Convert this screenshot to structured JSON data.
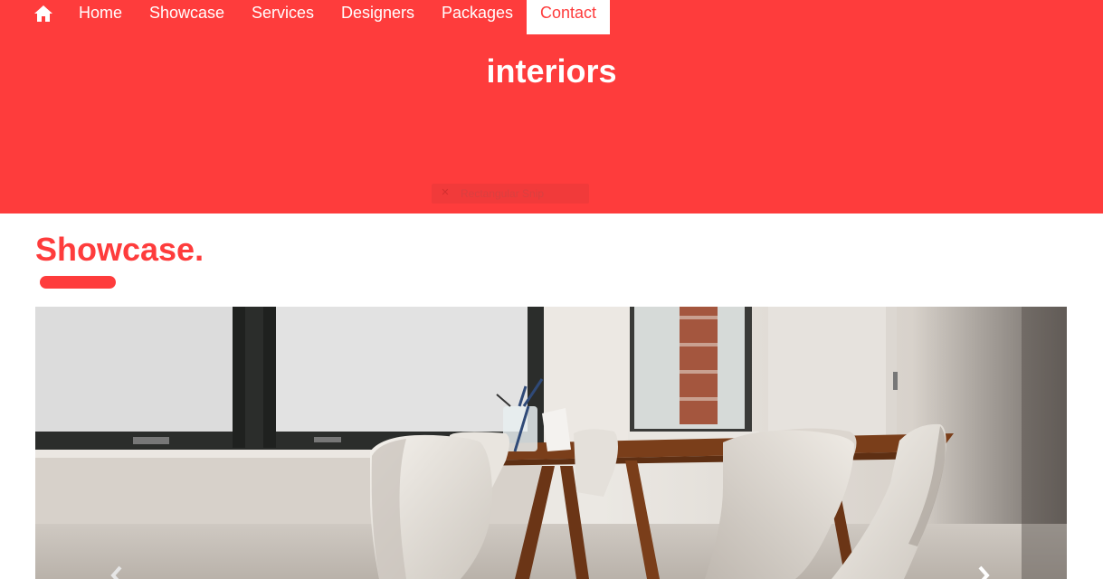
{
  "nav": {
    "home_icon": "home-icon",
    "items": [
      {
        "label": "Home"
      },
      {
        "label": "Showcase"
      },
      {
        "label": "Services"
      },
      {
        "label": "Designers"
      },
      {
        "label": "Packages"
      },
      {
        "label": "Contact",
        "active": true
      }
    ]
  },
  "hero": {
    "brand": "interiors",
    "overlay_label": "Rectangular Snip"
  },
  "showcase": {
    "title": "Showcase."
  },
  "colors": {
    "accent": "#fe3c3c",
    "white": "#ffffff"
  },
  "carousel": {
    "prev_icon": "chevron-left-icon",
    "next_icon": "chevron-right-icon"
  }
}
